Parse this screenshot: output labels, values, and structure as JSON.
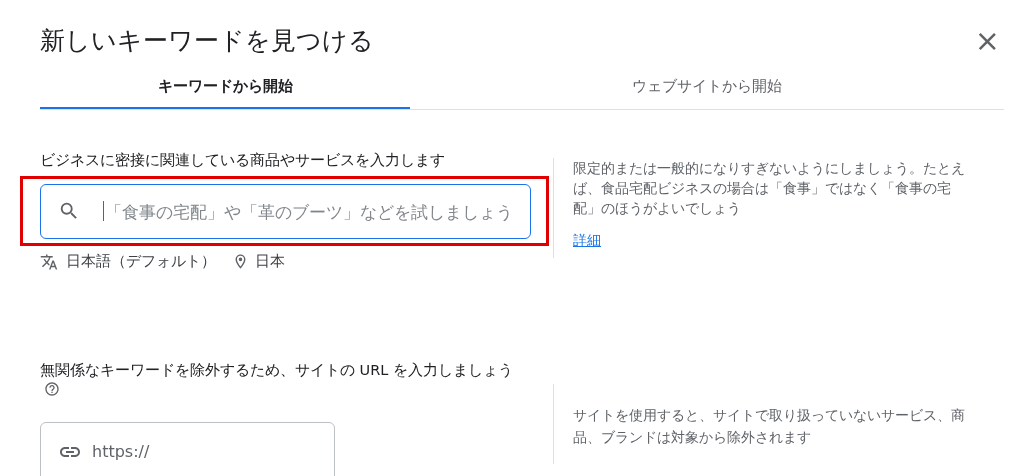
{
  "dialog": {
    "title": "新しいキーワードを見つける",
    "close": "×"
  },
  "tabs": [
    {
      "label": "キーワードから開始",
      "selected": true
    },
    {
      "label": "ウェブサイトから開始",
      "selected": false
    }
  ],
  "keyword_section": {
    "label": "ビジネスに密接に関連している商品やサービスを入力します",
    "field": {
      "placeholder": "「食事の宅配」や「革のブーツ」などを試しましょう",
      "focused": true,
      "highlighted": true
    },
    "language": "日本語（デフォルト）",
    "location": "日本",
    "help": "限定的または一般的になりすぎないようにしましょう。たとえば、食品宅配ビジネスの場合は「食事」ではなく「食事の宅配」のほうがよいでしょう",
    "link": "詳細"
  },
  "site_section": {
    "label": "無関係なキーワードを除外するため、サイトの URL を入力しましょう",
    "field": {
      "placeholder": "https://"
    },
    "help": "サイトを使用すると、サイトで取り扱っていないサービス、商品、ブランドは対象から除外されます"
  }
}
